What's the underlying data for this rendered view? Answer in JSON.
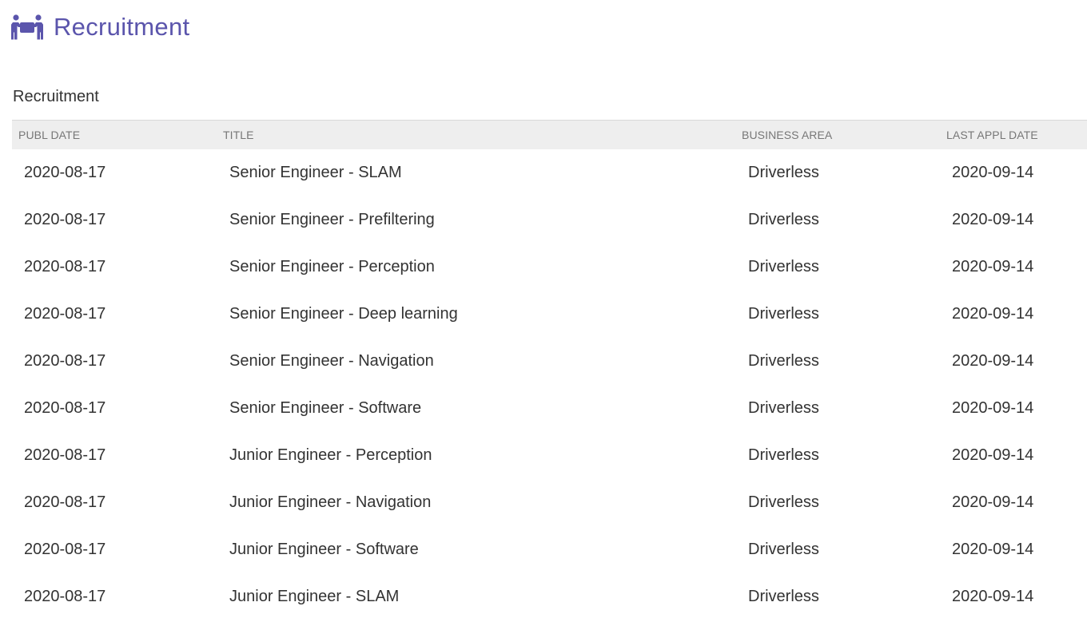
{
  "header": {
    "icon": "people-carry-icon",
    "accent_color": "#5b55ac",
    "title": "Recruitment"
  },
  "section": {
    "title": "Recruitment"
  },
  "table": {
    "columns": [
      "PUBL DATE",
      "TITLE",
      "BUSINESS AREA",
      "LAST APPL DATE"
    ],
    "rows": [
      {
        "publ_date": "2020-08-17",
        "title": "Senior Engineer - SLAM",
        "business_area": "Driverless",
        "last_appl_date": "2020-09-14"
      },
      {
        "publ_date": "2020-08-17",
        "title": "Senior Engineer - Prefiltering",
        "business_area": "Driverless",
        "last_appl_date": "2020-09-14"
      },
      {
        "publ_date": "2020-08-17",
        "title": "Senior Engineer - Perception",
        "business_area": "Driverless",
        "last_appl_date": "2020-09-14"
      },
      {
        "publ_date": "2020-08-17",
        "title": "Senior Engineer - Deep learning",
        "business_area": "Driverless",
        "last_appl_date": "2020-09-14"
      },
      {
        "publ_date": "2020-08-17",
        "title": "Senior Engineer - Navigation",
        "business_area": "Driverless",
        "last_appl_date": "2020-09-14"
      },
      {
        "publ_date": "2020-08-17",
        "title": "Senior Engineer - Software",
        "business_area": "Driverless",
        "last_appl_date": "2020-09-14"
      },
      {
        "publ_date": "2020-08-17",
        "title": "Junior Engineer - Perception",
        "business_area": "Driverless",
        "last_appl_date": "2020-09-14"
      },
      {
        "publ_date": "2020-08-17",
        "title": "Junior Engineer - Navigation",
        "business_area": "Driverless",
        "last_appl_date": "2020-09-14"
      },
      {
        "publ_date": "2020-08-17",
        "title": "Junior Engineer - Software",
        "business_area": "Driverless",
        "last_appl_date": "2020-09-14"
      },
      {
        "publ_date": "2020-08-17",
        "title": "Junior Engineer - SLAM",
        "business_area": "Driverless",
        "last_appl_date": "2020-09-14"
      }
    ]
  }
}
